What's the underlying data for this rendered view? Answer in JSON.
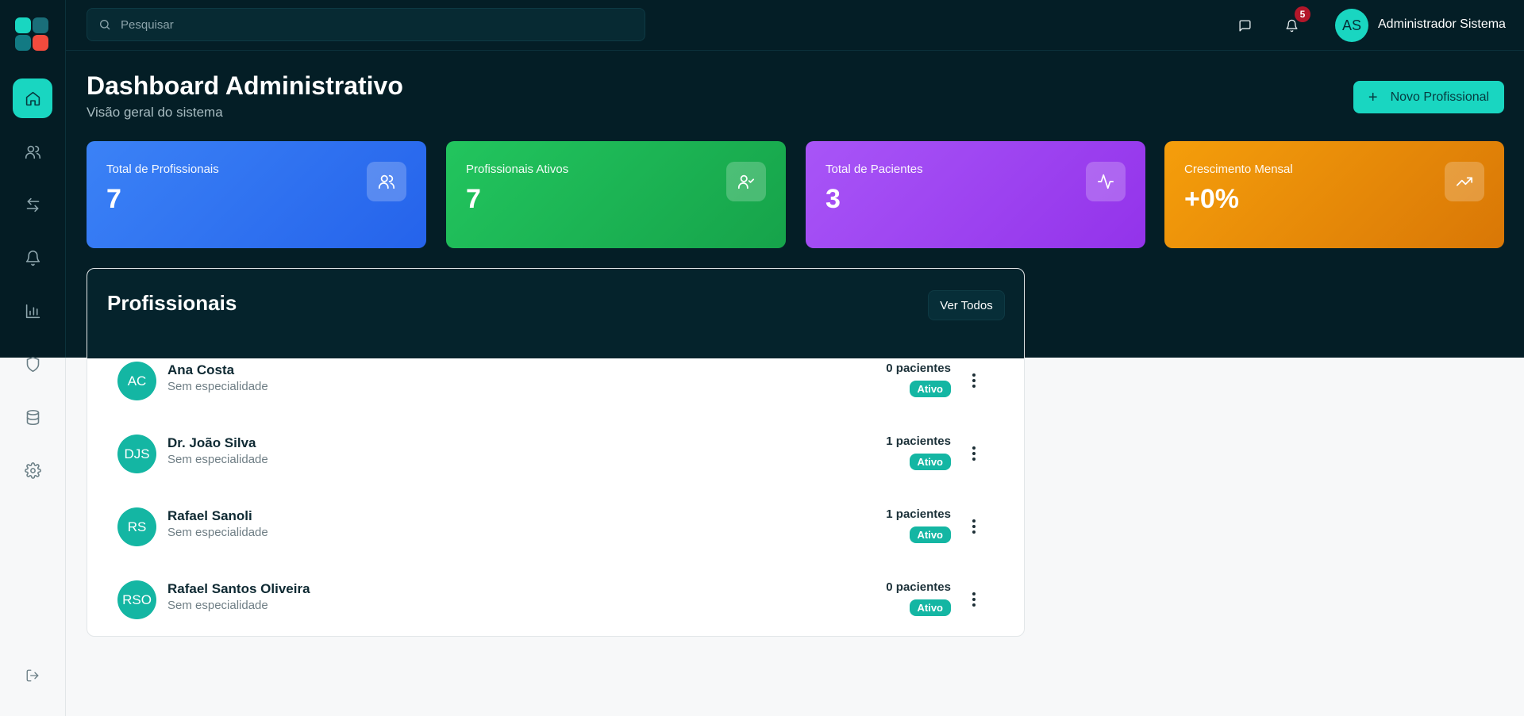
{
  "search": {
    "placeholder": "Pesquisar"
  },
  "topbar": {
    "notification_count": "5",
    "user_initials": "AS",
    "user_name": "Administrador Sistema"
  },
  "sidebar": {
    "items": [
      {
        "name": "home",
        "icon": "home-icon"
      },
      {
        "name": "users",
        "icon": "users-icon"
      },
      {
        "name": "transfers",
        "icon": "arrows-swap-icon"
      },
      {
        "name": "notifications",
        "icon": "bell-icon"
      },
      {
        "name": "reports",
        "icon": "bar-chart-icon"
      },
      {
        "name": "security",
        "icon": "shield-icon"
      },
      {
        "name": "database",
        "icon": "database-icon"
      },
      {
        "name": "settings",
        "icon": "gear-icon"
      }
    ],
    "logout_icon": "logout-icon",
    "logo_colors": [
      "#19d6c1",
      "#1a7f8a",
      "#127a83",
      "#f24b3d"
    ]
  },
  "header": {
    "title": "Dashboard Administrativo",
    "subtitle": "Visão geral do sistema",
    "new_button": "Novo Profissional"
  },
  "stats": [
    {
      "label": "Total de Profissionais",
      "value": "7",
      "icon": "users-icon",
      "color_from": "#3b82f6",
      "color_to": "#2563eb"
    },
    {
      "label": "Profissionais Ativos",
      "value": "7",
      "icon": "user-check-icon",
      "color_from": "#22c55e",
      "color_to": "#16a34a"
    },
    {
      "label": "Total de Pacientes",
      "value": "3",
      "icon": "activity-icon",
      "color_from": "#a855f7",
      "color_to": "#9333ea"
    },
    {
      "label": "Crescimento Mensal",
      "value": "+0%",
      "icon": "trending-up-icon",
      "color_from": "#f59e0b",
      "color_to": "#d97706"
    }
  ],
  "professionals": {
    "title": "Profissionais",
    "view_all": "Ver Todos",
    "rows": [
      {
        "initials": "AC",
        "name": "Ana Costa",
        "specialty": "Sem especialidade",
        "patients": "0 pacientes",
        "status": "Ativo"
      },
      {
        "initials": "DJS",
        "name": "Dr. João Silva",
        "specialty": "Sem especialidade",
        "patients": "1 pacientes",
        "status": "Ativo"
      },
      {
        "initials": "RS",
        "name": "Rafael Sanoli",
        "specialty": "Sem especialidade",
        "patients": "1 pacientes",
        "status": "Ativo"
      },
      {
        "initials": "RSO",
        "name": "Rafael Santos Oliveira",
        "specialty": "Sem especialidade",
        "patients": "0 pacientes",
        "status": "Ativo"
      }
    ]
  },
  "colors": {
    "accent": "#19d6c1",
    "dark_bg": "#041e26",
    "badge_red": "#b3172a",
    "status_teal": "#14b6a3"
  }
}
